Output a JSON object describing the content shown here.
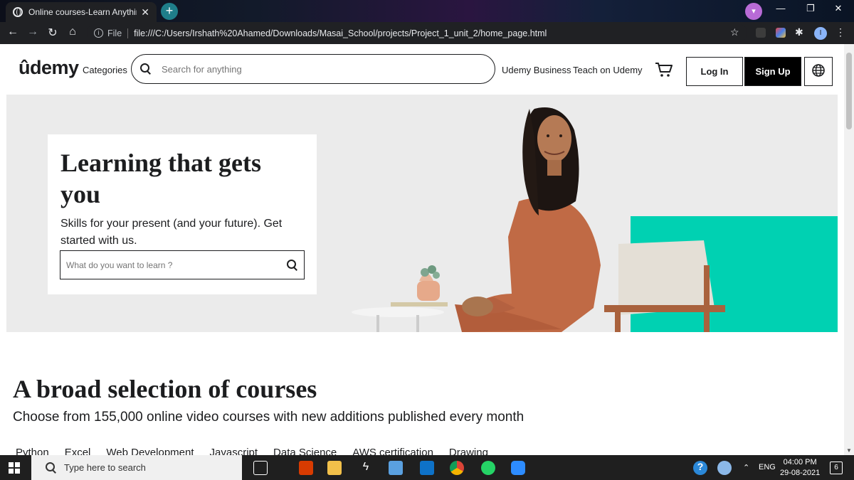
{
  "browser": {
    "tab_title": "Online courses-Learn Anything, C",
    "tab_close": "✕",
    "new_tab": "+",
    "address": {
      "scheme_label": "File",
      "url": "file:///C:/Users/Irshath%20Ahamed/Downloads/Masai_School/projects/Project_1_unit_2/home_page.html"
    },
    "profile_initial": "I"
  },
  "header": {
    "logo": "ûdemy",
    "categories": "Categories",
    "search_placeholder": "Search for anything",
    "udemy_business": "Udemy Business",
    "teach": "Teach on Udemy",
    "login": "Log In",
    "signup": "Sign Up"
  },
  "hero": {
    "title": "Learning that gets you",
    "subtitle": "Skills for your present (and your future). Get started with us.",
    "search_placeholder": "What do you want to learn ?"
  },
  "section": {
    "title": "A broad selection of courses",
    "subtitle": "Choose from 155,000 online video courses with new additions published every month",
    "topics": [
      "Python",
      "Excel",
      "Web Development",
      "Javascript",
      "Data Science",
      "AWS certification",
      "Drawing"
    ]
  },
  "taskbar": {
    "search_placeholder": "Type here to search",
    "lang": "ENG",
    "time": "04:00 PM",
    "date": "29-08-2021",
    "notification_count": "6"
  },
  "colors": {
    "accent_teal": "#00d1b2",
    "brand_purple": "#a435f0",
    "hero_bg": "#ebebeb",
    "text_dark": "#1c1d1f"
  }
}
